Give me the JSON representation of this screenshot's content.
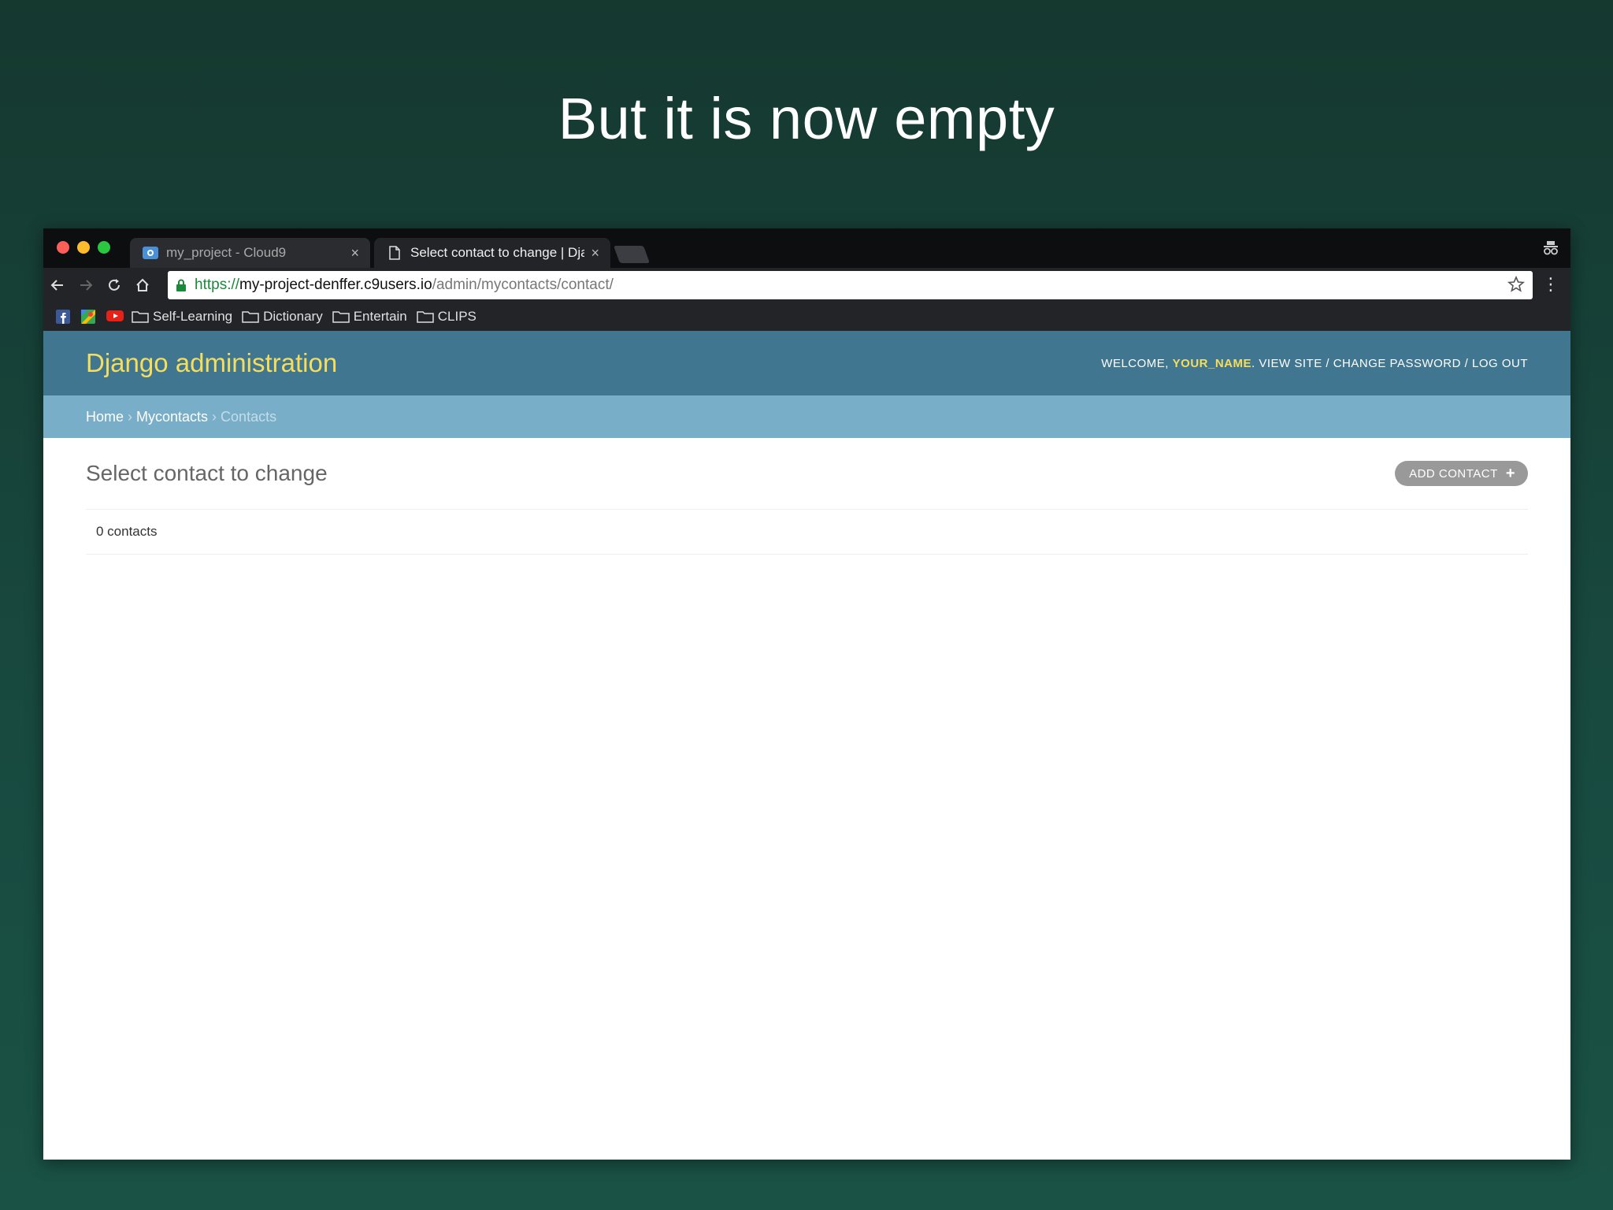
{
  "slide": {
    "title": "But it is now empty"
  },
  "browser": {
    "tabs": [
      {
        "label": "my_project - Cloud9",
        "close": "×"
      },
      {
        "label": "Select contact to change | Dja",
        "close": "×"
      }
    ],
    "address": {
      "scheme": "https://",
      "host": "my-project-denffer.c9users.io",
      "path": "/admin/mycontacts/contact/"
    },
    "bookmarks": [
      {
        "label": "Self-Learning"
      },
      {
        "label": "Dictionary"
      },
      {
        "label": "Entertain"
      },
      {
        "label": "CLIPS"
      }
    ],
    "colors": {
      "frame": "#222428",
      "tabstrip": "#0d0e10"
    }
  },
  "django": {
    "branding": "Django administration",
    "user_tools": {
      "welcome": "WELCOME,",
      "username": "YOUR_NAME",
      "view_site": "VIEW SITE",
      "change_password": "CHANGE PASSWORD",
      "logout": "LOG OUT",
      "separator": " / "
    },
    "breadcrumbs": {
      "home": "Home",
      "app": "Mycontacts",
      "current": "Contacts",
      "separator": "›"
    },
    "page_title": "Select contact to change",
    "add_button": {
      "label": "ADD CONTACT",
      "icon": "+"
    },
    "result_count": "0 contacts",
    "colors": {
      "header": "#417690",
      "breadcrumbs": "#79aec8",
      "brand": "#f5dd5d"
    }
  }
}
